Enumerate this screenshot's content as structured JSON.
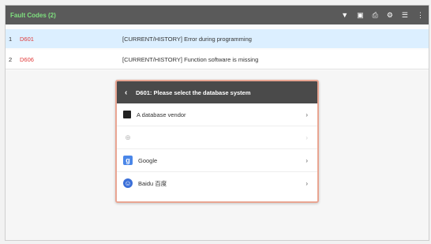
{
  "header": {
    "title": "Fault Codes (2)",
    "icons": [
      "wifi-icon",
      "screenshot-icon",
      "print-icon",
      "settings-icon",
      "menu-icon",
      "more-icon"
    ]
  },
  "fault_codes": [
    {
      "index": "1",
      "code": "D601",
      "description": "[CURRENT/HISTORY] Error during programming"
    },
    {
      "index": "2",
      "code": "D606",
      "description": "[CURRENT/HISTORY] Function software is missing"
    }
  ],
  "dialog": {
    "title": "D601: Please select the database system",
    "options": [
      {
        "label": "A database vendor",
        "icon": "book-icon",
        "enabled": true
      },
      {
        "label": "",
        "icon": "globe-icon",
        "enabled": false
      },
      {
        "label": "Google",
        "icon": "google-icon",
        "enabled": true
      },
      {
        "label": "Baidu 百度",
        "icon": "baidu-icon",
        "enabled": true
      }
    ]
  },
  "colors": {
    "header_bg": "#5a5a5a",
    "header_title": "#7fe07f",
    "selected_row": "#dcefff",
    "fault_code": "#e03a3a",
    "dialog_border": "#e9a592",
    "dialog_head": "#4a4a4a"
  }
}
